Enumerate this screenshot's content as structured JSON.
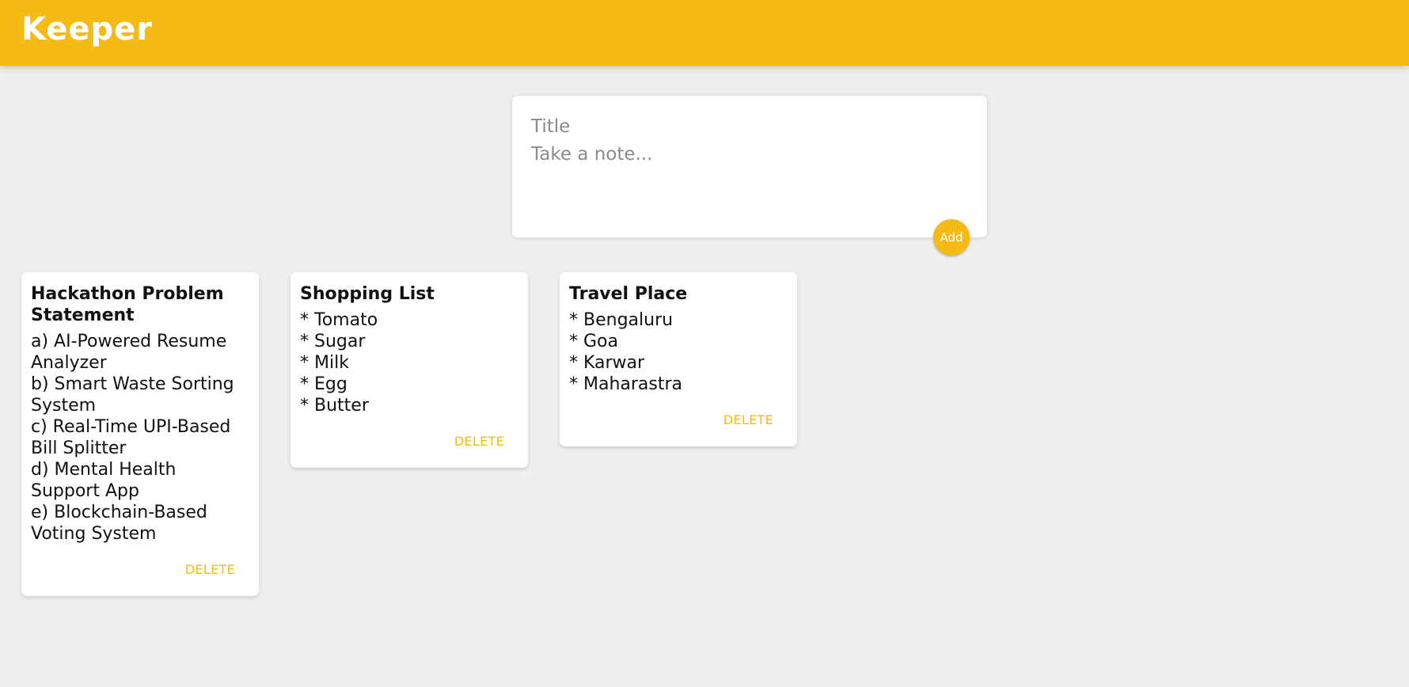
{
  "header": {
    "logo": "Keeper"
  },
  "create": {
    "title_placeholder": "Title",
    "content_placeholder": "Take a note...",
    "add_label": "Add"
  },
  "notes": [
    {
      "title": "Hackathon Problem Statement",
      "lines": [
        "a) AI-Powered Resume",
        "Analyzer",
        "b) Smart Waste Sorting",
        "System",
        "c) Real-Time UPI-Based",
        "Bill Splitter",
        "d) Mental Health",
        "Support App",
        "e) Blockchain-Based",
        "Voting System"
      ],
      "delete_label": "DELETE"
    },
    {
      "title": "Shopping List",
      "lines": [
        "* Tomato",
        "* Sugar",
        "* Milk",
        "* Egg",
        "* Butter"
      ],
      "delete_label": "DELETE"
    },
    {
      "title": "Travel Place",
      "lines": [
        "* Bengaluru",
        "* Goa",
        "* Karwar",
        "* Maharastra"
      ],
      "delete_label": "DELETE"
    }
  ],
  "colors": {
    "accent": "#f5ba13",
    "background": "#eeeeee"
  }
}
